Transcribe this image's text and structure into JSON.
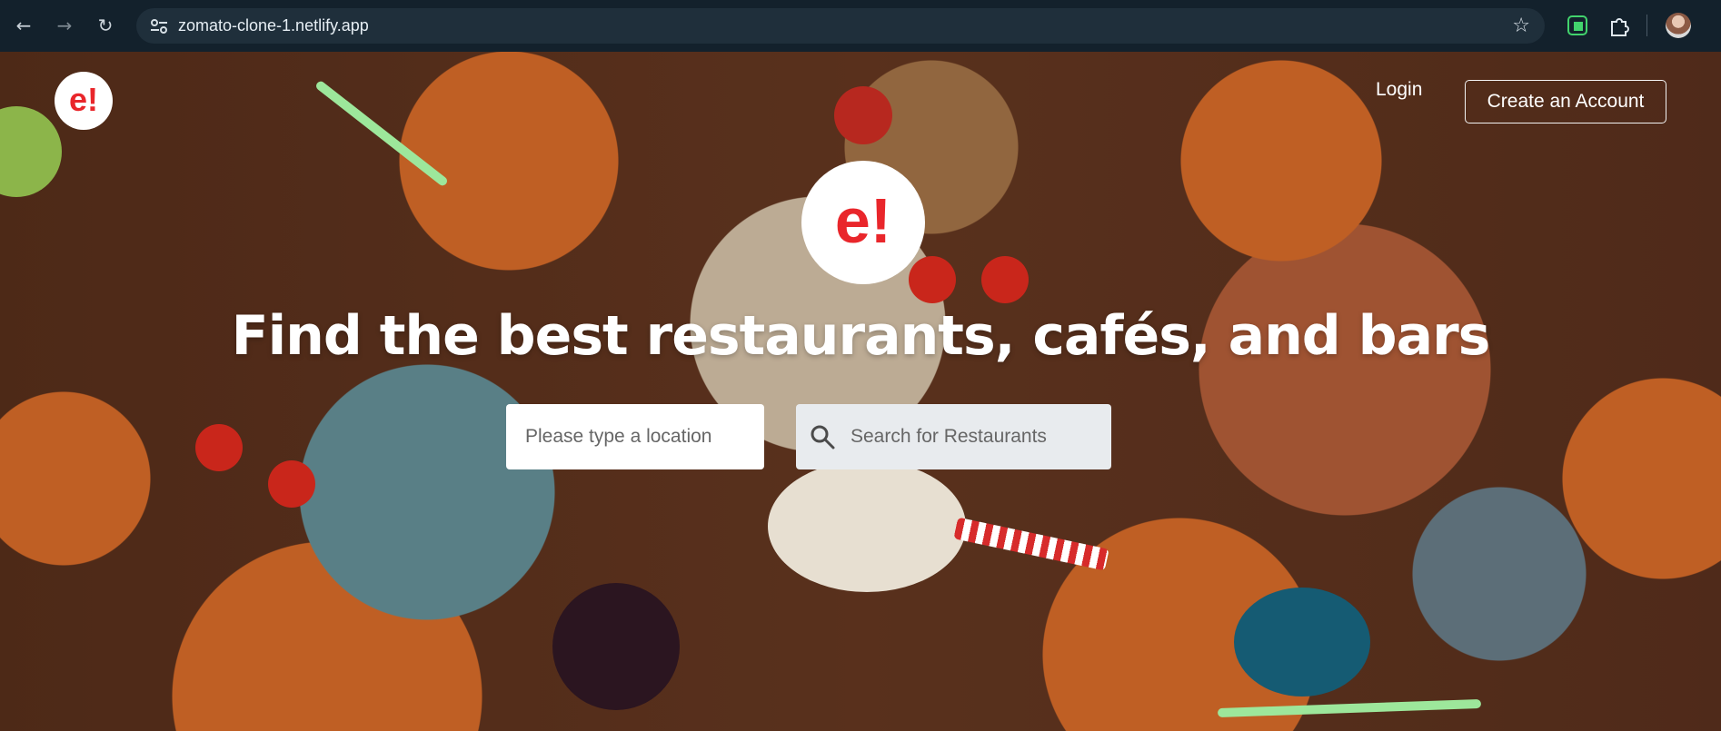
{
  "browser": {
    "url": "zomato-clone-1.netlify.app",
    "icons": [
      "back-icon",
      "forward-icon",
      "reload-icon",
      "site-info-icon",
      "star-icon",
      "extension-green-icon",
      "puzzle-icon",
      "profile-avatar"
    ]
  },
  "page": {
    "header_logo_text": "e!",
    "login_label": "Login",
    "create_account_label": "Create an Account",
    "hero_logo_text": "e!",
    "headline": "Find the best restaurants, cafés, and bars",
    "location_placeholder": "Please type a location",
    "search_placeholder": "Search for Restaurants"
  },
  "colors": {
    "brand_red": "#e9262b",
    "chrome_bg": "#13212c",
    "search_bg": "#e8ebee"
  }
}
